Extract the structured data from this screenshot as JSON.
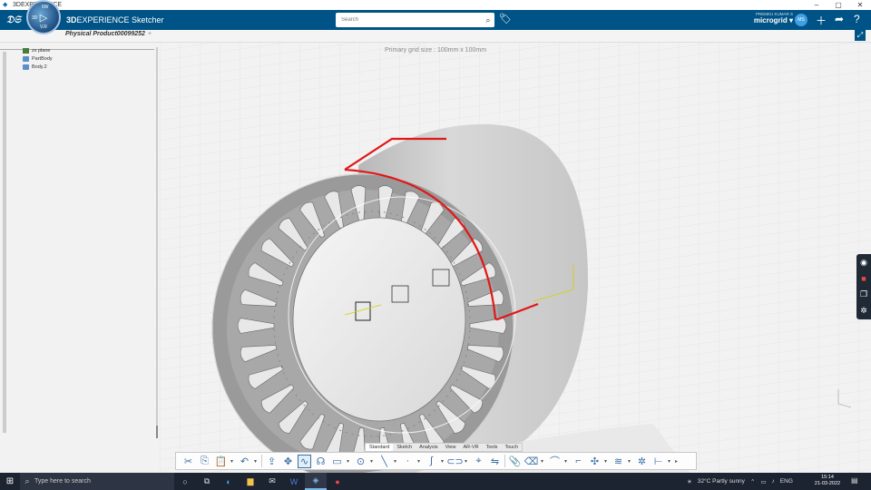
{
  "window": {
    "title": "3DEXPERIENCE",
    "controls": [
      "–",
      "▢",
      "✕"
    ]
  },
  "appbar": {
    "brand_bold": "3D",
    "brand_rest": "EXPERIENCE Sketcher",
    "compass_version": "V.R",
    "compass_left": "3D",
    "compass_top": "6W",
    "search_placeholder": "Search",
    "user_name": "PREMKU KUMAR S",
    "tenant": "microgrid",
    "avatar_initials": "MS"
  },
  "tabbar": {
    "active_tab": "Physical Product00099252",
    "add_tab": "+"
  },
  "viewport": {
    "grid_label": "Primary grid size : 100mm x 100mm",
    "tree": [
      {
        "label": "zx plane",
        "type": "plane"
      },
      {
        "label": "PartBody",
        "type": "body"
      },
      {
        "label": "Body.2",
        "type": "body"
      }
    ]
  },
  "action_tabs": [
    {
      "label": "Standard",
      "active": true
    },
    {
      "label": "Sketch",
      "active": false
    },
    {
      "label": "Analysis",
      "active": false
    },
    {
      "label": "View",
      "active": false
    },
    {
      "label": "AR-VR",
      "active": false
    },
    {
      "label": "Tools",
      "active": false
    },
    {
      "label": "Touch",
      "active": false
    }
  ],
  "taskbar": {
    "search_text": "Type here to search",
    "weather": "32°C  Partly sunny",
    "language": "ENG",
    "time": "15:14",
    "date": "21-03-2022"
  },
  "colors": {
    "header_blue": "#005386",
    "sketch_red": "#e01818",
    "taskbar": "#1c2331"
  }
}
